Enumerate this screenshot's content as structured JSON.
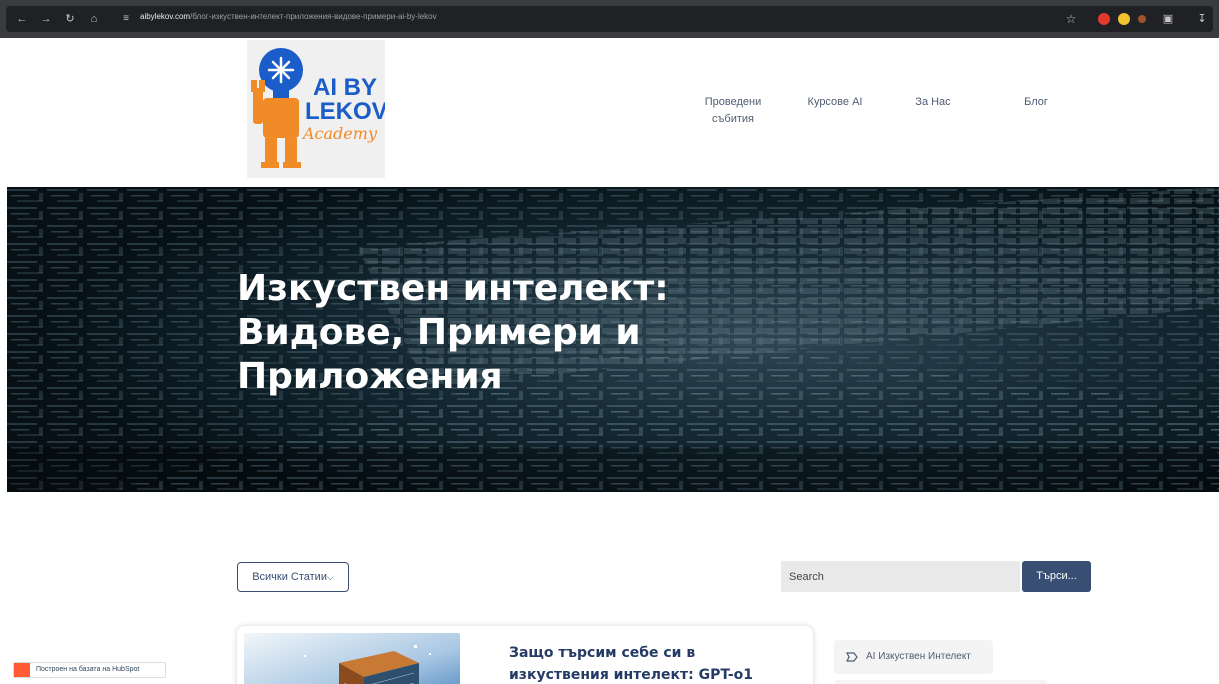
{
  "browser": {
    "url_host": "aibylekov.com",
    "url_path": "/блог-изкуствен-интелект-приложения-видове-примери-ai-by-lekov"
  },
  "logo": {
    "line1": "AI BY",
    "line2": "LEKOV",
    "line3": "Academy"
  },
  "nav": {
    "items": [
      "Проведени събития",
      "Курсове AI",
      "За Нас",
      "Блог"
    ]
  },
  "hero": {
    "title": "Изкуствен интелект: Видове, Примери и Приложения"
  },
  "filter": {
    "label": "Всички Статии"
  },
  "search": {
    "placeholder": "Search",
    "button_label": "Търси..."
  },
  "post": {
    "title": "Защо търсим себе си в изкуствения интелект: GPT-o1"
  },
  "sidebar": {
    "tag_label": "AI Изкуствен Интелект"
  },
  "hubspot": {
    "label": "Построен на базата на HubSpot"
  },
  "colors": {
    "accent": "#394e73",
    "post_title": "#253b66",
    "logo_blue": "#1a5cc8",
    "logo_orange": "#f08b28"
  }
}
